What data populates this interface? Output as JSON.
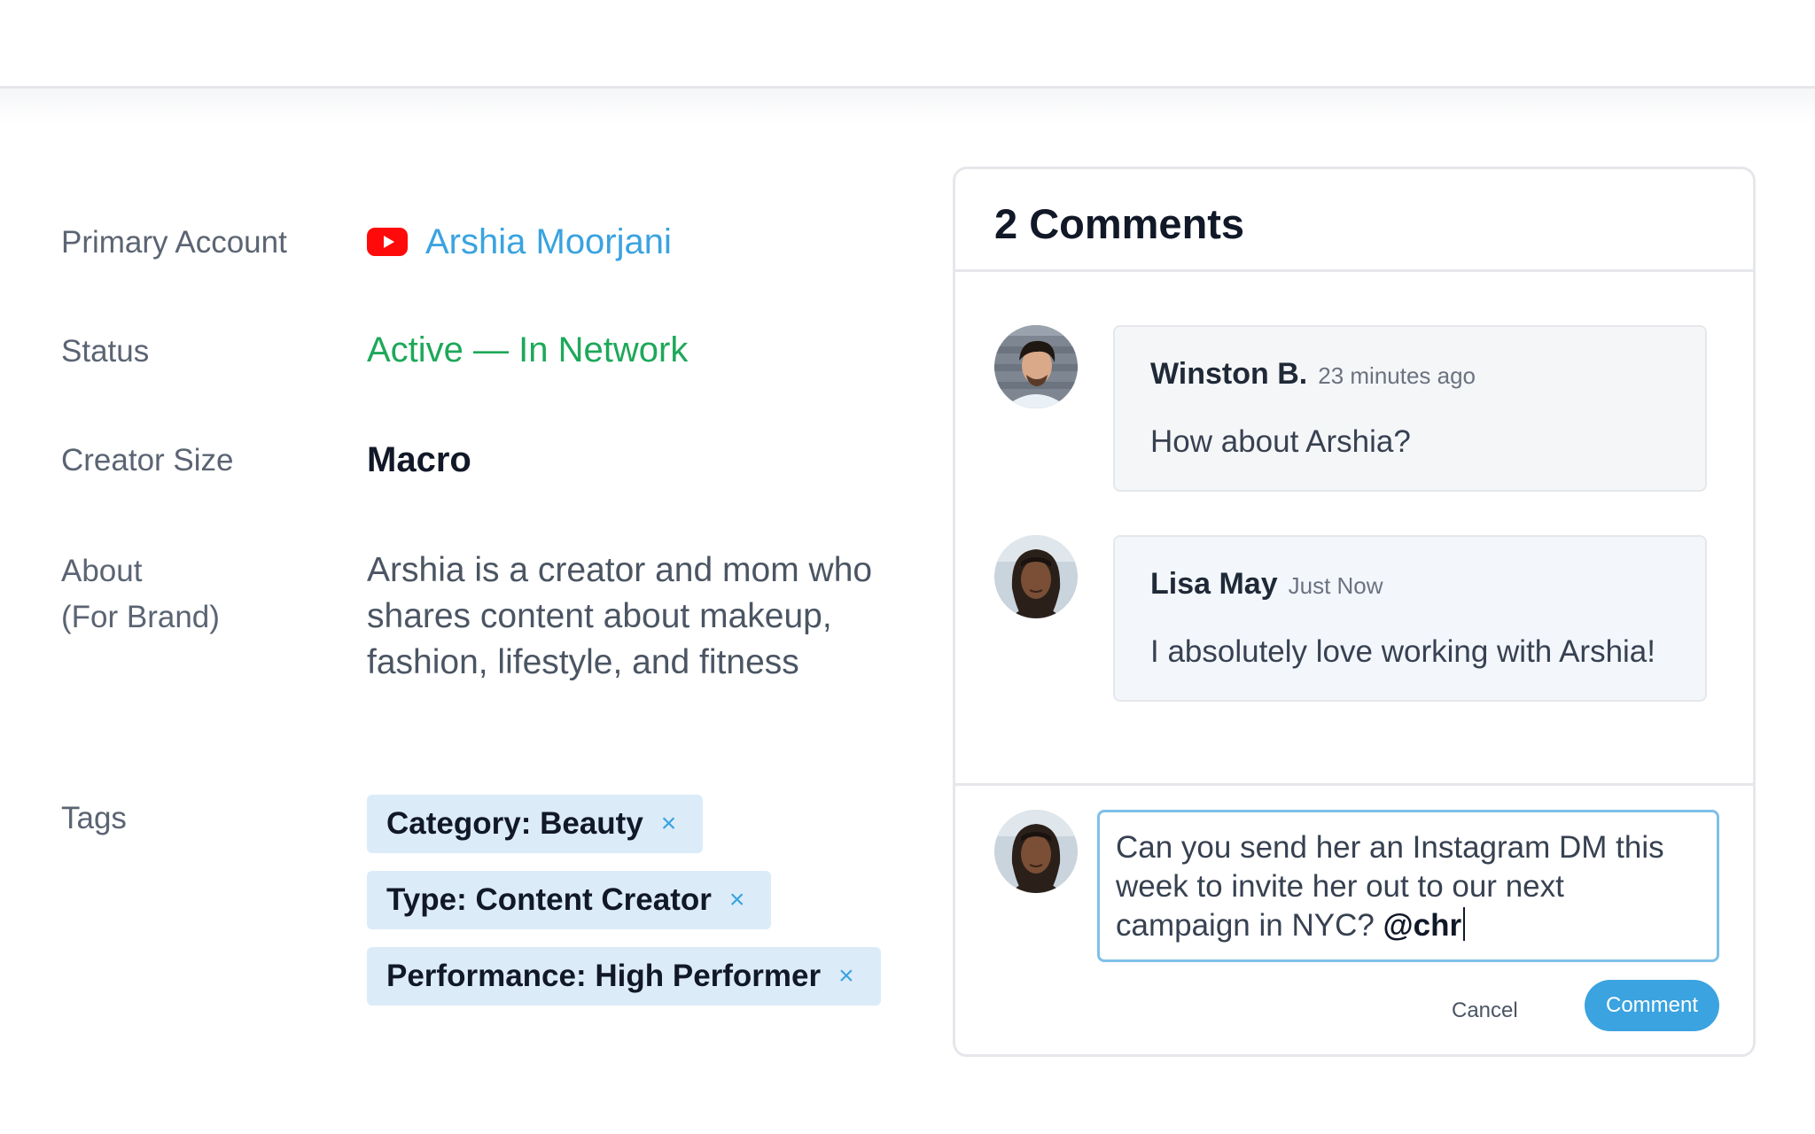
{
  "details": {
    "primary_account": {
      "label": "Primary Account",
      "platform_icon": "youtube-icon",
      "name": "Arshia Moorjani"
    },
    "status": {
      "label": "Status",
      "value": "Active — In Network"
    },
    "creator_size": {
      "label": "Creator Size",
      "value": "Macro"
    },
    "about": {
      "label_line1": "About",
      "label_line2": "(For Brand)",
      "value": "Arshia is a creator and mom who shares content about makeup, fashion, lifestyle, and fitness"
    },
    "tags": {
      "label": "Tags",
      "items": [
        "Category: Beauty",
        "Type: Content Creator",
        "Performance: High Performer"
      ],
      "remove_glyph": "×"
    }
  },
  "comments": {
    "title": "2 Comments",
    "items": [
      {
        "author": "Winston B.",
        "time": "23 minutes ago",
        "text": "How about Arshia?"
      },
      {
        "author": "Lisa May",
        "time": "Just Now",
        "text": "I absolutely love working with Arshia!"
      }
    ],
    "compose": {
      "text": "Can you send her an Instagram DM this week to invite her out to our next campaign in NYC? ",
      "mention": "@chr"
    },
    "cancel_label": "Cancel",
    "submit_label": "Comment"
  },
  "colors": {
    "accent": "#3aa3e0",
    "status_green": "#1ea85a",
    "youtube_red": "#ff0a0a",
    "tag_bg": "#dcebf8"
  }
}
